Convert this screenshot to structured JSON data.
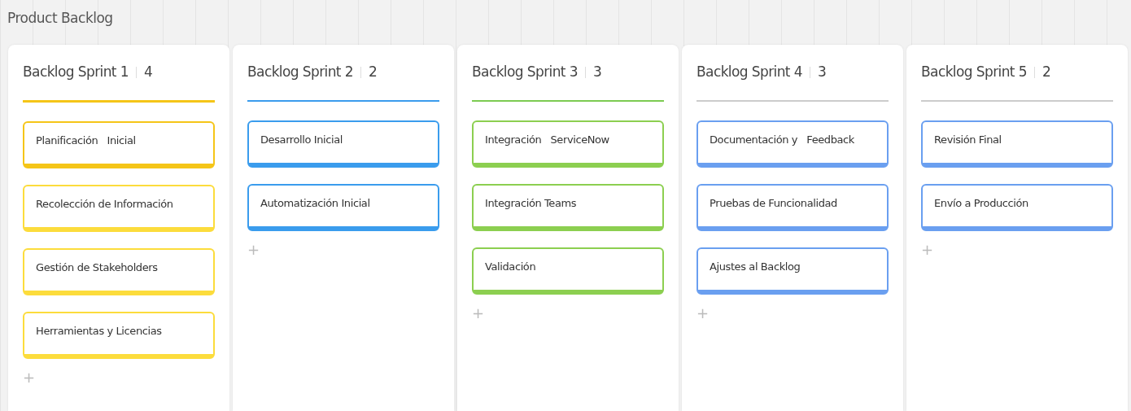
{
  "board": {
    "title": "Product Backlog"
  },
  "columns": [
    {
      "title": "Backlog Sprint 1",
      "count": "4",
      "color": "#f5c518",
      "add": "+",
      "cards": [
        {
          "title": "Planificación   Inicial",
          "color": "#f5c518"
        },
        {
          "title": "Recolección de Información",
          "color": "#fcdc3c"
        },
        {
          "title": "Gestión de Stakeholders",
          "color": "#fcdc3c"
        },
        {
          "title": "Herramientas y Licencias",
          "color": "#fcdc3c"
        }
      ]
    },
    {
      "title": "Backlog Sprint 2",
      "count": "2",
      "color": "#3a9ced",
      "add": "+",
      "cards": [
        {
          "title": "Desarrollo Inicial",
          "color": "#3a9ced"
        },
        {
          "title": "Automatización Inicial",
          "color": "#3a9ced"
        }
      ]
    },
    {
      "title": "Backlog Sprint 3",
      "count": "3",
      "color": "#7ccb52",
      "add": "+",
      "cards": [
        {
          "title": "Integración   ServiceNow",
          "color": "#8ccf50"
        },
        {
          "title": "Integración Teams",
          "color": "#8ccf50"
        },
        {
          "title": "Validación",
          "color": "#8ccf50"
        }
      ]
    },
    {
      "title": "Backlog Sprint 4",
      "count": "3",
      "color": "#cccccc",
      "add": "+",
      "cards": [
        {
          "title": "Documentación y   Feedback",
          "color": "#6a9ff0"
        },
        {
          "title": "Pruebas de Funcionalidad",
          "color": "#6a9ff0"
        },
        {
          "title": "Ajustes al Backlog",
          "color": "#6a9ff0"
        }
      ]
    },
    {
      "title": "Backlog Sprint 5",
      "count": "2",
      "color": "#cccccc",
      "add": "+",
      "cards": [
        {
          "title": "Revisión Final",
          "color": "#6a9ff0"
        },
        {
          "title": "Envío a Producción",
          "color": "#6a9ff0"
        }
      ]
    }
  ]
}
